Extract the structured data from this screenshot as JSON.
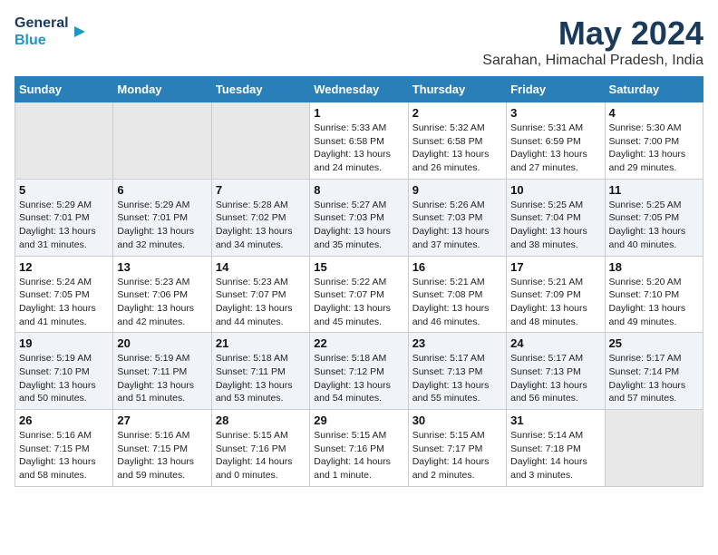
{
  "logo": {
    "line1": "General",
    "line2": "Blue"
  },
  "title": "May 2024",
  "location": "Sarahan, Himachal Pradesh, India",
  "weekdays": [
    "Sunday",
    "Monday",
    "Tuesday",
    "Wednesday",
    "Thursday",
    "Friday",
    "Saturday"
  ],
  "weeks": [
    [
      {
        "day": "",
        "info": ""
      },
      {
        "day": "",
        "info": ""
      },
      {
        "day": "",
        "info": ""
      },
      {
        "day": "1",
        "info": "Sunrise: 5:33 AM\nSunset: 6:58 PM\nDaylight: 13 hours\nand 24 minutes."
      },
      {
        "day": "2",
        "info": "Sunrise: 5:32 AM\nSunset: 6:58 PM\nDaylight: 13 hours\nand 26 minutes."
      },
      {
        "day": "3",
        "info": "Sunrise: 5:31 AM\nSunset: 6:59 PM\nDaylight: 13 hours\nand 27 minutes."
      },
      {
        "day": "4",
        "info": "Sunrise: 5:30 AM\nSunset: 7:00 PM\nDaylight: 13 hours\nand 29 minutes."
      }
    ],
    [
      {
        "day": "5",
        "info": "Sunrise: 5:29 AM\nSunset: 7:01 PM\nDaylight: 13 hours\nand 31 minutes."
      },
      {
        "day": "6",
        "info": "Sunrise: 5:29 AM\nSunset: 7:01 PM\nDaylight: 13 hours\nand 32 minutes."
      },
      {
        "day": "7",
        "info": "Sunrise: 5:28 AM\nSunset: 7:02 PM\nDaylight: 13 hours\nand 34 minutes."
      },
      {
        "day": "8",
        "info": "Sunrise: 5:27 AM\nSunset: 7:03 PM\nDaylight: 13 hours\nand 35 minutes."
      },
      {
        "day": "9",
        "info": "Sunrise: 5:26 AM\nSunset: 7:03 PM\nDaylight: 13 hours\nand 37 minutes."
      },
      {
        "day": "10",
        "info": "Sunrise: 5:25 AM\nSunset: 7:04 PM\nDaylight: 13 hours\nand 38 minutes."
      },
      {
        "day": "11",
        "info": "Sunrise: 5:25 AM\nSunset: 7:05 PM\nDaylight: 13 hours\nand 40 minutes."
      }
    ],
    [
      {
        "day": "12",
        "info": "Sunrise: 5:24 AM\nSunset: 7:05 PM\nDaylight: 13 hours\nand 41 minutes."
      },
      {
        "day": "13",
        "info": "Sunrise: 5:23 AM\nSunset: 7:06 PM\nDaylight: 13 hours\nand 42 minutes."
      },
      {
        "day": "14",
        "info": "Sunrise: 5:23 AM\nSunset: 7:07 PM\nDaylight: 13 hours\nand 44 minutes."
      },
      {
        "day": "15",
        "info": "Sunrise: 5:22 AM\nSunset: 7:07 PM\nDaylight: 13 hours\nand 45 minutes."
      },
      {
        "day": "16",
        "info": "Sunrise: 5:21 AM\nSunset: 7:08 PM\nDaylight: 13 hours\nand 46 minutes."
      },
      {
        "day": "17",
        "info": "Sunrise: 5:21 AM\nSunset: 7:09 PM\nDaylight: 13 hours\nand 48 minutes."
      },
      {
        "day": "18",
        "info": "Sunrise: 5:20 AM\nSunset: 7:10 PM\nDaylight: 13 hours\nand 49 minutes."
      }
    ],
    [
      {
        "day": "19",
        "info": "Sunrise: 5:19 AM\nSunset: 7:10 PM\nDaylight: 13 hours\nand 50 minutes."
      },
      {
        "day": "20",
        "info": "Sunrise: 5:19 AM\nSunset: 7:11 PM\nDaylight: 13 hours\nand 51 minutes."
      },
      {
        "day": "21",
        "info": "Sunrise: 5:18 AM\nSunset: 7:11 PM\nDaylight: 13 hours\nand 53 minutes."
      },
      {
        "day": "22",
        "info": "Sunrise: 5:18 AM\nSunset: 7:12 PM\nDaylight: 13 hours\nand 54 minutes."
      },
      {
        "day": "23",
        "info": "Sunrise: 5:17 AM\nSunset: 7:13 PM\nDaylight: 13 hours\nand 55 minutes."
      },
      {
        "day": "24",
        "info": "Sunrise: 5:17 AM\nSunset: 7:13 PM\nDaylight: 13 hours\nand 56 minutes."
      },
      {
        "day": "25",
        "info": "Sunrise: 5:17 AM\nSunset: 7:14 PM\nDaylight: 13 hours\nand 57 minutes."
      }
    ],
    [
      {
        "day": "26",
        "info": "Sunrise: 5:16 AM\nSunset: 7:15 PM\nDaylight: 13 hours\nand 58 minutes."
      },
      {
        "day": "27",
        "info": "Sunrise: 5:16 AM\nSunset: 7:15 PM\nDaylight: 13 hours\nand 59 minutes."
      },
      {
        "day": "28",
        "info": "Sunrise: 5:15 AM\nSunset: 7:16 PM\nDaylight: 14 hours\nand 0 minutes."
      },
      {
        "day": "29",
        "info": "Sunrise: 5:15 AM\nSunset: 7:16 PM\nDaylight: 14 hours\nand 1 minute."
      },
      {
        "day": "30",
        "info": "Sunrise: 5:15 AM\nSunset: 7:17 PM\nDaylight: 14 hours\nand 2 minutes."
      },
      {
        "day": "31",
        "info": "Sunrise: 5:14 AM\nSunset: 7:18 PM\nDaylight: 14 hours\nand 3 minutes."
      },
      {
        "day": "",
        "info": ""
      }
    ]
  ]
}
